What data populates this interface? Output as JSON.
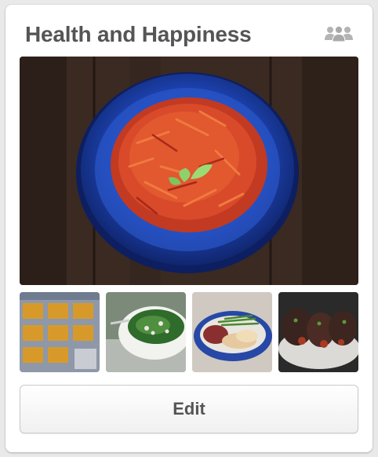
{
  "board": {
    "title": "Health and Happiness",
    "collaborators_icon": "group-icon",
    "cover_image": "carrot-beet-salad-photo",
    "thumbnails": [
      {
        "image": "baked-squares-photo"
      },
      {
        "image": "greens-salad-bowl-photo"
      },
      {
        "image": "chicken-green-beans-plate-photo"
      },
      {
        "image": "eggplant-dish-photo"
      }
    ],
    "edit_label": "Edit"
  },
  "colors": {
    "title_text": "#555555",
    "card_background": "#ffffff",
    "page_background": "#e9e9e9",
    "plate_blue": "#1f47b8",
    "icon_gray": "#b4b4b4"
  }
}
